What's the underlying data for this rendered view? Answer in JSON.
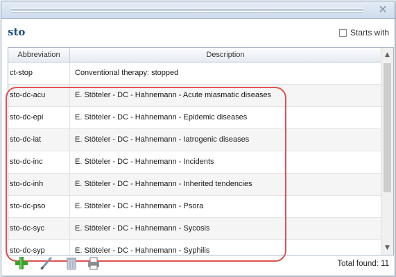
{
  "window": {
    "close_icon": "close-icon"
  },
  "search": {
    "query": "sto",
    "starts_with_label": "Starts with",
    "starts_with_checked": false
  },
  "table": {
    "columns": [
      "Abbreviation",
      "Description"
    ],
    "rows": [
      {
        "abbr": "ct-stop",
        "desc": "Conventional therapy: stopped"
      },
      {
        "abbr": "sto-dc-acu",
        "desc": "E. Stöteler - DC - Hahnemann - Acute miasmatic diseases"
      },
      {
        "abbr": "sto-dc-epi",
        "desc": "E. Stöteler - DC - Hahnemann - Epidemic diseases"
      },
      {
        "abbr": "sto-dc-iat",
        "desc": "E. Stöteler - DC - Hahnemann - Iatrogenic diseases"
      },
      {
        "abbr": "sto-dc-inc",
        "desc": "E. Stöteler - DC - Hahnemann - Incidents"
      },
      {
        "abbr": "sto-dc-inh",
        "desc": "E. Stöteler - DC - Hahnemann - Inherited tendencies"
      },
      {
        "abbr": "sto-dc-pso",
        "desc": "E. Stöteler - DC - Hahnemann - Psora"
      },
      {
        "abbr": "sto-dc-syc",
        "desc": "E. Stöteler - DC - Hahnemann - Sycosis"
      },
      {
        "abbr": "sto-dc-syp",
        "desc": "E. Stöteler - DC - Hahnemann - Syphilis"
      }
    ]
  },
  "toolbar": {
    "icons": [
      "add-icon",
      "edit-icon",
      "delete-icon",
      "print-icon"
    ]
  },
  "footer": {
    "total": "Total found: 11"
  },
  "colors": {
    "title": "#1f4f8a",
    "highlight": "#e05252",
    "add": "#3aa12f"
  }
}
